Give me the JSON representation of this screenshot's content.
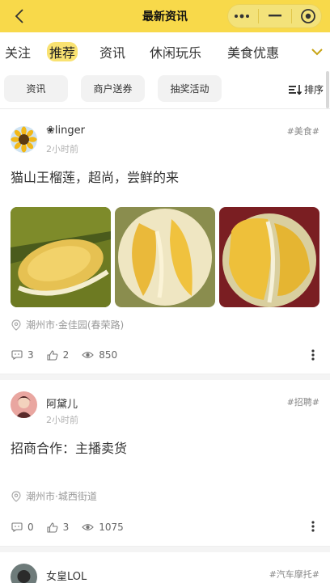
{
  "header": {
    "title": "最新资讯"
  },
  "tabs": [
    "关注",
    "推荐",
    "资讯",
    "休闲玩乐",
    "美食优惠"
  ],
  "filters": [
    "资讯",
    "商户送券",
    "抽奖活动"
  ],
  "sort_label": "排序",
  "posts": [
    {
      "user": "❀linger",
      "time": "2小时前",
      "tag": "#美食#",
      "text": "猫山王榴莲，超尚，尝鲜的来",
      "images": [
        "durian-photo-1",
        "durian-photo-2",
        "durian-photo-3"
      ],
      "location": "潮州市·金佳园(春荣路)",
      "comments": "3",
      "likes": "2",
      "views": "850"
    },
    {
      "user": "阿黛儿",
      "time": "2小时前",
      "tag": "#招聘#",
      "text": "招商合作：主播卖货",
      "location": "潮州市·城西街道",
      "comments": "0",
      "likes": "3",
      "views": "1075"
    },
    {
      "user": "女皇LOL",
      "tag": "#汽车摩托#"
    }
  ],
  "colors": {
    "header_bg": "#f8d94a",
    "tab_highlight": "#f8dd59",
    "chip_bg": "#f2f2f2"
  }
}
